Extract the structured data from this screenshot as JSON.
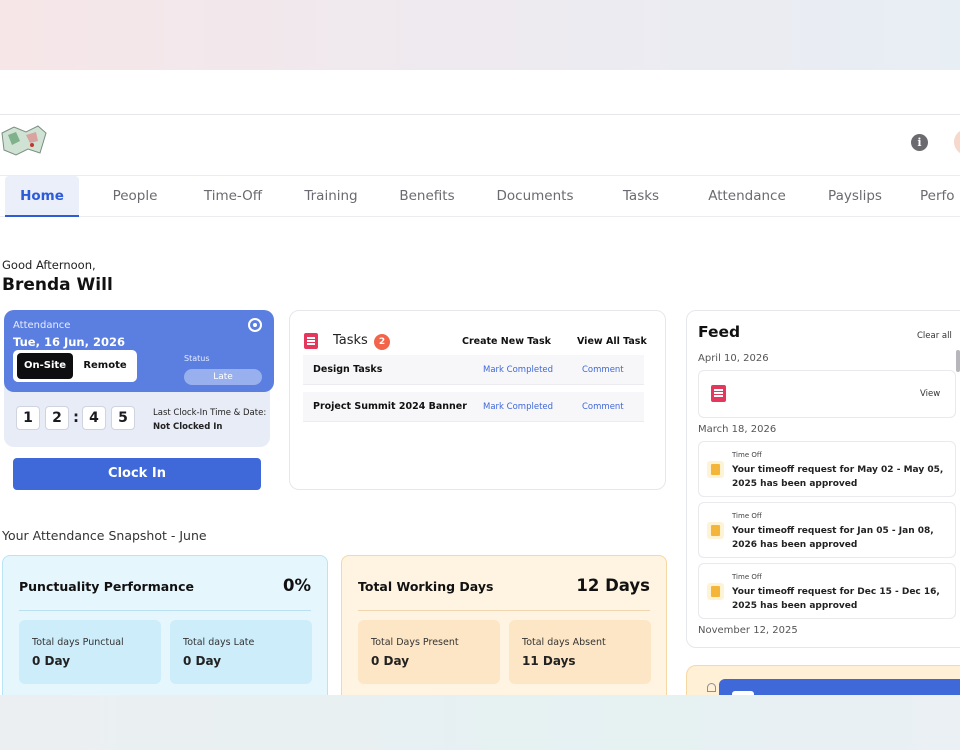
{
  "header": {
    "logo_alt": "map-logo",
    "icons": [
      "info-icon",
      "avatar"
    ]
  },
  "tabs": [
    {
      "label": "Home",
      "active": true
    },
    {
      "label": "People"
    },
    {
      "label": "Time-Off"
    },
    {
      "label": "Training"
    },
    {
      "label": "Benefits"
    },
    {
      "label": "Documents"
    },
    {
      "label": "Tasks"
    },
    {
      "label": "Attendance"
    },
    {
      "label": "Payslips"
    },
    {
      "label": "Perfo"
    }
  ],
  "greeting": {
    "text": "Good Afternoon,",
    "name": "Brenda Will"
  },
  "attendance": {
    "label": "Attendance",
    "date": "Tue, 16 Jun, 2026",
    "mode_on": "On-Site",
    "mode_off": "Remote",
    "status_label": "Status",
    "status_value": "Late",
    "digits": [
      "1",
      "2",
      "4",
      "5"
    ],
    "last_clock_label": "Last Clock-In Time & Date:",
    "last_clock_value": "Not Clocked In",
    "clock_in_label": "Clock In"
  },
  "tasks": {
    "title": "Tasks",
    "count": "2",
    "create_label": "Create New Task",
    "view_all_label": "View All Task",
    "items": [
      {
        "name": "Design Tasks",
        "mark": "Mark Completed",
        "comment": "Comment"
      },
      {
        "name": "Project Summit 2024 Banner",
        "mark": "Mark Completed",
        "comment": "Comment"
      }
    ]
  },
  "snapshot": {
    "title": "Your Attendance Snapshot - June",
    "punctuality": {
      "title": "Punctuality Performance",
      "value": "0%",
      "box1_label": "Total days Punctual",
      "box1_value": "0 Day",
      "box2_label": "Total days Late",
      "box2_value": "0 Day"
    },
    "working": {
      "title": "Total Working Days",
      "value": "12 Days",
      "box1_label": "Total Days Present",
      "box1_value": "0 Day",
      "box2_label": "Total days Absent",
      "box2_value": "11 Days"
    }
  },
  "feed": {
    "title": "Feed",
    "clear_all": "Clear all",
    "date1": "April 10, 2026",
    "view_label": "View",
    "date2": "March 18, 2026",
    "items": [
      {
        "label": "Time Off",
        "text": "Your timeoff request for May 02 - May 05, 2025 has been approved"
      },
      {
        "label": "Time Off",
        "text": "Your timeoff request for Jan 05 - Jan 08, 2026 has been approved"
      },
      {
        "label": "Time Off",
        "text": "Your timeoff request for Dec 15 - Dec 16, 2025 has been approved"
      }
    ],
    "date3": "November 12, 2025"
  },
  "colors": {
    "accent": "#3f68d8",
    "attendance_card": "#5b7fe0",
    "task_badge": "#f2654b",
    "task_icon": "#e5365e"
  }
}
